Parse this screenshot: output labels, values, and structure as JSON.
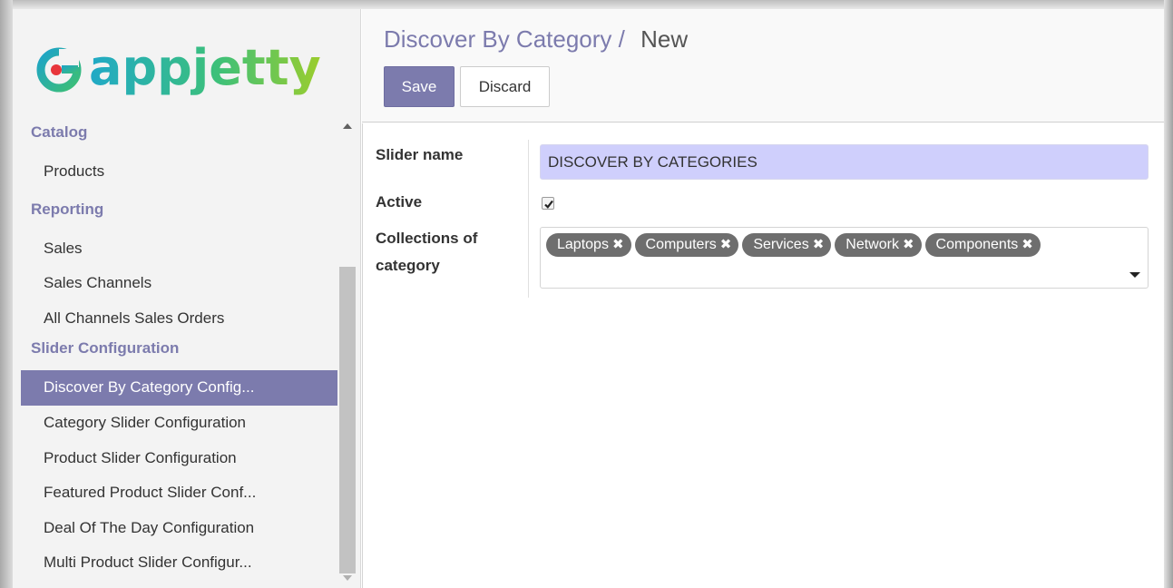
{
  "brand": {
    "logo_text": "appjetty"
  },
  "sidebar": {
    "sections": [
      {
        "heading": "Catalog",
        "items": [
          "Products"
        ]
      },
      {
        "heading": "Reporting",
        "items": [
          "Sales",
          "Sales Channels",
          "All Channels Sales Orders"
        ]
      },
      {
        "heading": "Slider Configuration",
        "items": [
          "Discover By Category Config...",
          "Category Slider Configuration",
          "Product Slider Configuration",
          "Featured Product Slider Conf...",
          "Deal Of The Day Configuration",
          "Multi Product Slider Configur..."
        ]
      }
    ],
    "active_item": "Discover By Category Config..."
  },
  "header": {
    "breadcrumb_parent": "Discover By Category",
    "breadcrumb_sep": "/",
    "breadcrumb_current": "New",
    "save_label": "Save",
    "discard_label": "Discard"
  },
  "form": {
    "slider_name_label": "Slider name",
    "slider_name_value": "DISCOVER BY CATEGORIES",
    "active_label": "Active",
    "active_checked": true,
    "collections_label_line1": "Collections of",
    "collections_label_line2": "category",
    "tags": [
      "Laptops",
      "Computers",
      "Services",
      "Network",
      "Components"
    ],
    "tag_remove_glyph": "✖"
  },
  "colors": {
    "accent": "#7c7bad",
    "input_bg": "#cfcffc",
    "tag_bg": "#6e6e6e"
  }
}
